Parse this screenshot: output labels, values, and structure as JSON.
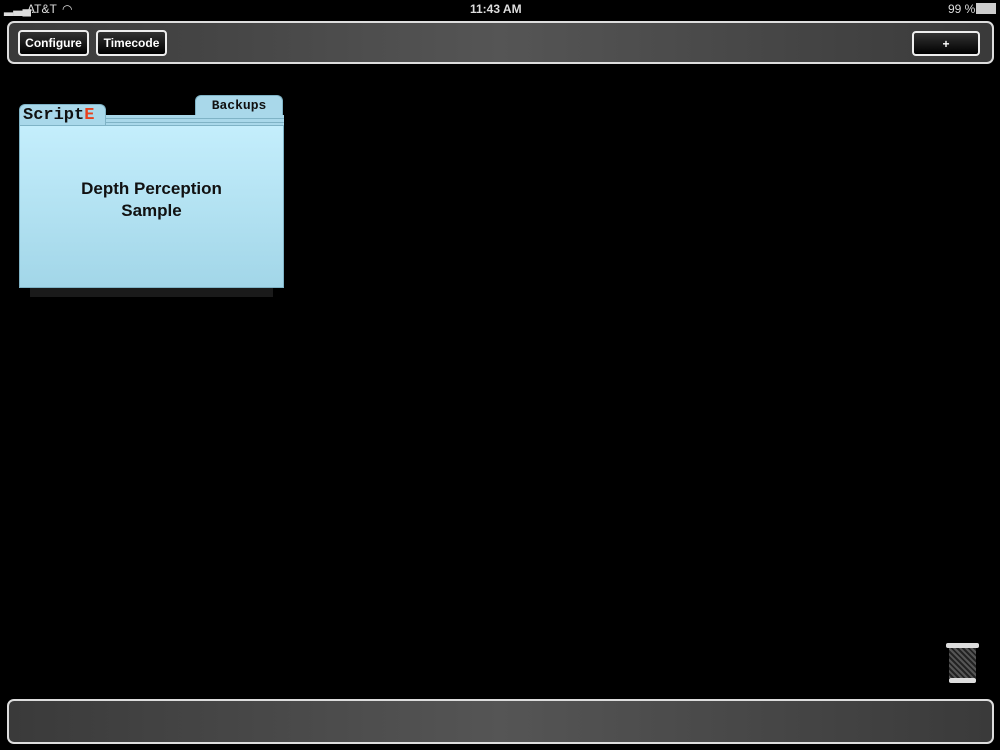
{
  "status": {
    "carrier": "AT&T",
    "time": "11:43 AM",
    "battery": "99 %"
  },
  "toolbar": {
    "configure": "Configure",
    "timecode": "Timecode",
    "add": "+"
  },
  "folder": {
    "logo": "Script",
    "logo_accent": "E",
    "tab": "Backups",
    "title_line1": "Depth Perception",
    "title_line2": "Sample"
  },
  "colors": {
    "accent": "#e8401c",
    "folder": "#b8e6f6"
  }
}
